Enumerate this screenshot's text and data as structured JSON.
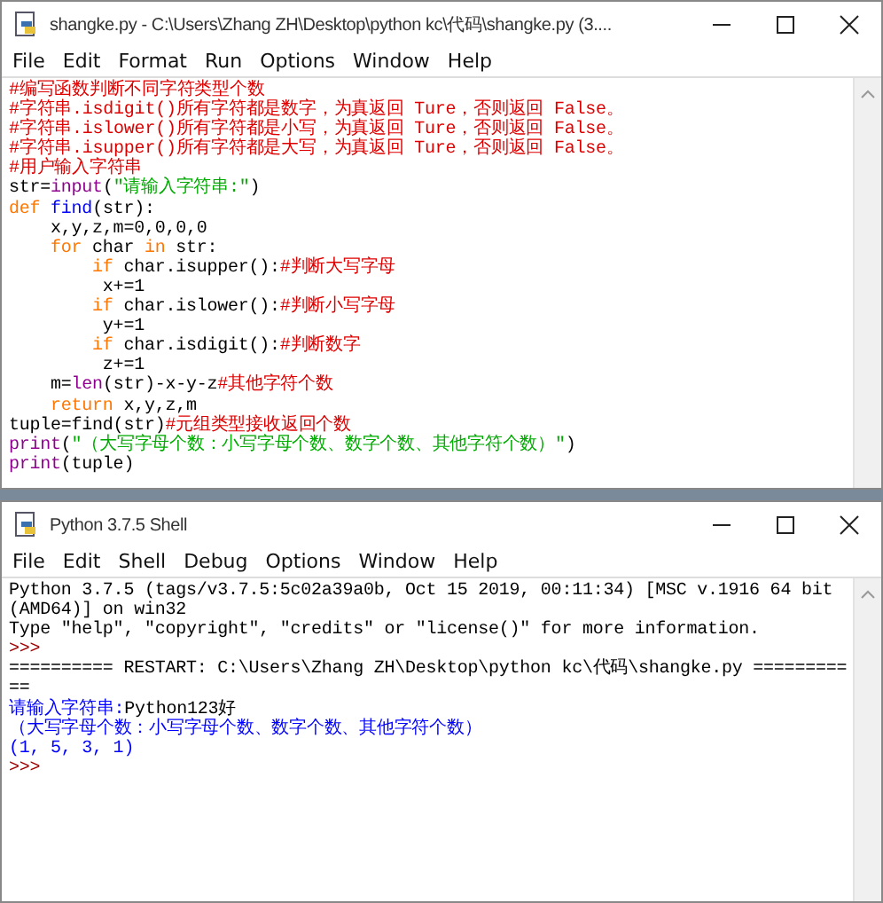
{
  "editor": {
    "title": "shangke.py - C:\\Users\\Zhang ZH\\Desktop\\python kc\\代码\\shangke.py (3....",
    "menu": [
      "File",
      "Edit",
      "Format",
      "Run",
      "Options",
      "Window",
      "Help"
    ],
    "lines": [
      [
        {
          "kind": "comment",
          "text": "#编写函数判断不同字符类型个数"
        }
      ],
      [
        {
          "kind": "comment",
          "text": "#字符串.isdigit()所有字符都是数字，为真返回 Ture，否则返回 False。"
        }
      ],
      [
        {
          "kind": "comment",
          "text": "#字符串.islower()所有字符都是小写，为真返回 Ture，否则返回 False。"
        }
      ],
      [
        {
          "kind": "comment",
          "text": "#字符串.isupper()所有字符都是大写，为真返回 Ture，否则返回 False。"
        }
      ],
      [
        {
          "kind": "comment",
          "text": "#用户输入字符串"
        }
      ],
      [
        {
          "kind": "plain",
          "text": "str="
        },
        {
          "kind": "builtin",
          "text": "input"
        },
        {
          "kind": "plain",
          "text": "("
        },
        {
          "kind": "string",
          "text": "\"请输入字符串:\""
        },
        {
          "kind": "plain",
          "text": ")"
        }
      ],
      [
        {
          "kind": "keyword",
          "text": "def"
        },
        {
          "kind": "definition",
          "text": " find"
        },
        {
          "kind": "plain",
          "text": "(str):"
        }
      ],
      [
        {
          "kind": "plain",
          "text": "    x,y,z,m=0,0,0,0"
        }
      ],
      [
        {
          "kind": "keyword",
          "text": "    for"
        },
        {
          "kind": "plain",
          "text": " char "
        },
        {
          "kind": "keyword",
          "text": "in"
        },
        {
          "kind": "plain",
          "text": " str:"
        }
      ],
      [
        {
          "kind": "keyword",
          "text": "        if"
        },
        {
          "kind": "plain",
          "text": " char.isupper():"
        },
        {
          "kind": "comment",
          "text": "#判断大写字母"
        }
      ],
      [
        {
          "kind": "plain",
          "text": "         x+=1"
        }
      ],
      [
        {
          "kind": "keyword",
          "text": "        if"
        },
        {
          "kind": "plain",
          "text": " char.islower():"
        },
        {
          "kind": "comment",
          "text": "#判断小写字母"
        }
      ],
      [
        {
          "kind": "plain",
          "text": "         y+=1"
        }
      ],
      [
        {
          "kind": "keyword",
          "text": "        if"
        },
        {
          "kind": "plain",
          "text": " char.isdigit():"
        },
        {
          "kind": "comment",
          "text": "#判断数字"
        }
      ],
      [
        {
          "kind": "plain",
          "text": "         z+=1"
        }
      ],
      [
        {
          "kind": "plain",
          "text": "    m="
        },
        {
          "kind": "builtin",
          "text": "len"
        },
        {
          "kind": "plain",
          "text": "(str)-x-y-z"
        },
        {
          "kind": "comment",
          "text": "#其他字符个数"
        }
      ],
      [
        {
          "kind": "keyword",
          "text": "    return"
        },
        {
          "kind": "plain",
          "text": " x,y,z,m"
        }
      ],
      [
        {
          "kind": "plain",
          "text": "tuple=find(str)"
        },
        {
          "kind": "comment",
          "text": "#元组类型接收返回个数"
        }
      ],
      [
        {
          "kind": "builtin",
          "text": "print"
        },
        {
          "kind": "plain",
          "text": "("
        },
        {
          "kind": "string",
          "text": "\"（大写字母个数：小写字母个数、数字个数、其他字符个数）\""
        },
        {
          "kind": "plain",
          "text": ")"
        }
      ],
      [
        {
          "kind": "builtin",
          "text": "print"
        },
        {
          "kind": "plain",
          "text": "(tuple)"
        }
      ]
    ]
  },
  "shell": {
    "title": "Python 3.7.5 Shell",
    "menu": [
      "File",
      "Edit",
      "Shell",
      "Debug",
      "Options",
      "Window",
      "Help"
    ],
    "lines": [
      [
        {
          "kind": "plain",
          "text": "Python 3.7.5 (tags/v3.7.5:5c02a39a0b, Oct 15 2019, 00:11:34) [MSC v.1916 64 bit"
        }
      ],
      [
        {
          "kind": "plain",
          "text": "(AMD64)] on win32"
        }
      ],
      [
        {
          "kind": "plain",
          "text": "Type \"help\", \"copyright\", \"credits\" or \"license()\" for more information."
        }
      ],
      [
        {
          "kind": "prompt",
          "text": ">>>"
        }
      ],
      [
        {
          "kind": "plain",
          "text": "========== RESTART: C:\\Users\\Zhang ZH\\Desktop\\python kc\\代码\\shangke.py ========="
        }
      ],
      [
        {
          "kind": "plain",
          "text": "=="
        }
      ],
      [
        {
          "kind": "stdout",
          "text": "请输入字符串:"
        },
        {
          "kind": "plain",
          "text": "Python123好"
        }
      ],
      [
        {
          "kind": "stdout",
          "text": "（大写字母个数：小写字母个数、数字个数、其他字符个数）"
        }
      ],
      [
        {
          "kind": "stdout",
          "text": "(1, 5, 3, 1)"
        }
      ],
      [
        {
          "kind": "prompt",
          "text": ">>>"
        }
      ]
    ]
  }
}
